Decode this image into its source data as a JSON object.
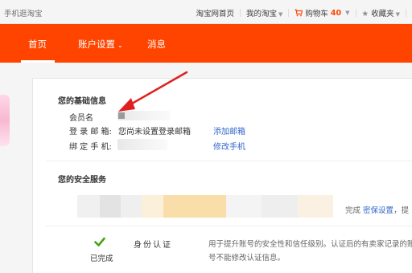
{
  "topbar": {
    "left_link": "手机逛淘宝",
    "home_link": "淘宝网首页",
    "my_taobao": "我的淘宝",
    "cart_label": "购物车",
    "cart_count": "40",
    "favorites": "收藏夹"
  },
  "nav": {
    "home": "首页",
    "account_settings": "账户设置",
    "messages": "消息"
  },
  "basic_info": {
    "title": "您的基础信息",
    "member_label": "会员名",
    "email_label": "登 录 邮 箱:",
    "email_value": "您尚未设置登录邮箱",
    "add_email": "添加邮箱",
    "phone_label": "绑 定 手 机:",
    "change_phone": "修改手机"
  },
  "security": {
    "title": "您的安全服务",
    "status_done": "完成",
    "security_settings": "密保设置",
    "status_trail": "，提",
    "auth_done": "已完成",
    "auth_name": "身份认证",
    "auth_desc": "用于提升账号的安全性和信任级别。认证后的有卖家记录的账号不能修改认证信息。"
  },
  "colors": {
    "brand": "#ff4400",
    "link": "#3366cc",
    "check": "#44a316",
    "arrow": "#e02020"
  }
}
